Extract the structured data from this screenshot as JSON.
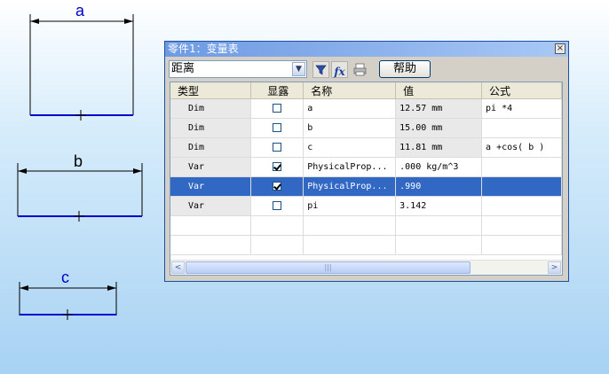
{
  "sketch": {
    "dim_a": "a",
    "dim_b": "b",
    "dim_c": "c"
  },
  "dialog": {
    "title": "零件1：变量表",
    "close_glyph": "×",
    "filter_selected": "距离",
    "help_label": "帮助",
    "fx_label": "fx"
  },
  "table": {
    "headers": [
      "类型",
      "显露",
      "名称",
      "值",
      "公式"
    ],
    "rows": [
      {
        "type": "Dim",
        "exposed": false,
        "name": "a",
        "value": "12.57 mm",
        "formula": "pi *4",
        "selected": false
      },
      {
        "type": "Dim",
        "exposed": false,
        "name": "b",
        "value": "15.00 mm",
        "formula": "",
        "selected": false
      },
      {
        "type": "Dim",
        "exposed": false,
        "name": "c",
        "value": "11.81 mm",
        "formula": "a +cos( b )",
        "selected": false
      },
      {
        "type": "Var",
        "exposed": true,
        "name": "PhysicalProp...",
        "value": ".000 kg/m^3",
        "formula": "",
        "selected": false
      },
      {
        "type": "Var",
        "exposed": true,
        "name": "PhysicalProp...",
        "value": ".990",
        "formula": "",
        "selected": true
      },
      {
        "type": "Var",
        "exposed": false,
        "name": "pi",
        "value": "3.142",
        "formula": "",
        "selected": false
      }
    ]
  },
  "scrollbar": {
    "left_arrow": "<",
    "right_arrow": ">",
    "grip": "|||"
  },
  "colors": {
    "selection": "#3168c3",
    "dimension_line": "#0000cc",
    "titlebar": "#6d9ae3"
  }
}
